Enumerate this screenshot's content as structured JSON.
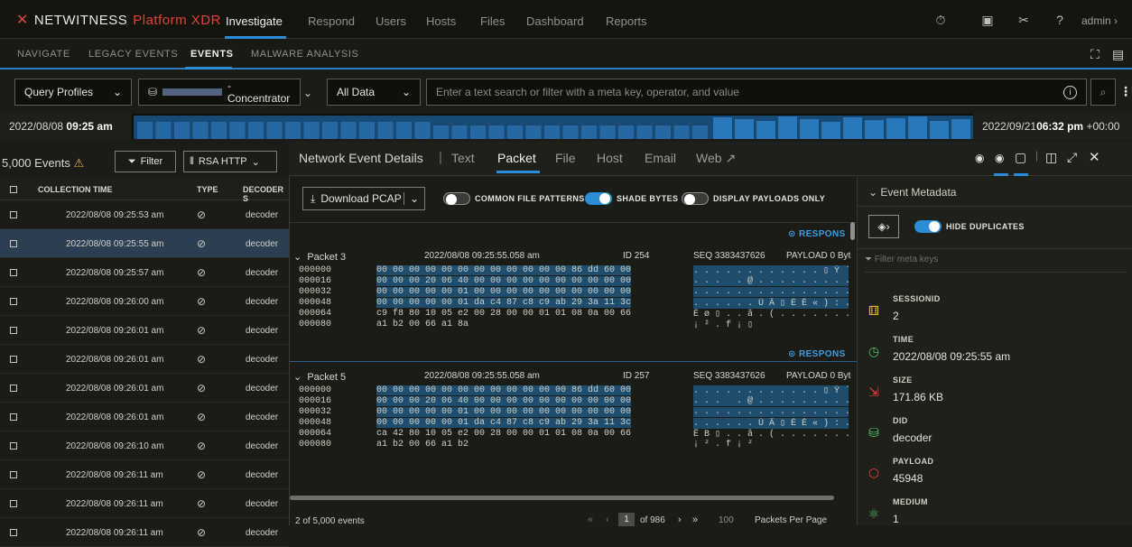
{
  "topbar": {
    "brand": "NETWITNESS",
    "platform": "Platform XDR",
    "nav": [
      "Investigate",
      "Respond",
      "Users",
      "Hosts",
      "Files",
      "Dashboard",
      "Reports"
    ],
    "user": "admin",
    "icons": [
      "stopwatch-icon",
      "notes-icon",
      "tools-icon",
      "help-icon"
    ]
  },
  "subnav": {
    "items": [
      "NAVIGATE",
      "LEGACY EVENTS",
      "EVENTS",
      "MALWARE ANALYSIS"
    ]
  },
  "query": {
    "profiles": "Query Profiles",
    "concentrator": "- Concentrator",
    "data": "All Data",
    "placeholder": "Enter a text search or filter with a meta key, operator, and value"
  },
  "timeline": {
    "start_date": "2022/08/08",
    "start_time": "09:25 am",
    "end_date": "2022/09/21",
    "end_time": "06:32 pm",
    "end_tz": "+00:00"
  },
  "events": {
    "count": "5,000 Events",
    "filter": "Filter",
    "service": "RSA HTTP",
    "columns": [
      "COLLECTION TIME",
      "TYPE",
      "DECODER S"
    ],
    "rows": [
      {
        "time": "2022/08/08 09:25:53 am",
        "type": "decoder"
      },
      {
        "time": "2022/08/08 09:25:55 am",
        "type": "decoder"
      },
      {
        "time": "2022/08/08 09:25:57 am",
        "type": "decoder"
      },
      {
        "time": "2022/08/08 09:26:00 am",
        "type": "decoder"
      },
      {
        "time": "2022/08/08 09:26:01 am",
        "type": "decoder"
      },
      {
        "time": "2022/08/08 09:26:01 am",
        "type": "decoder"
      },
      {
        "time": "2022/08/08 09:26:01 am",
        "type": "decoder"
      },
      {
        "time": "2022/08/08 09:26:01 am",
        "type": "decoder"
      },
      {
        "time": "2022/08/08 09:26:10 am",
        "type": "decoder"
      },
      {
        "time": "2022/08/08 09:26:11 am",
        "type": "decoder"
      },
      {
        "time": "2022/08/08 09:26:11 am",
        "type": "decoder"
      },
      {
        "time": "2022/08/08 09:26:11 am",
        "type": "decoder"
      }
    ]
  },
  "details": {
    "title": "Network Event Details",
    "tabs": [
      "Text",
      "Packet",
      "File",
      "Host",
      "Email",
      "Web"
    ],
    "download": "Download PCAP",
    "toggles": [
      "COMMON FILE PATTERNS",
      "SHADE BYTES",
      "DISPLAY PAYLOADS ONLY"
    ],
    "response": "RESPONS",
    "packets": [
      {
        "name": "Packet 3",
        "time": "2022/08/08 09:25:55.058 am",
        "id": "ID 254",
        "seq": "SEQ 3383437626",
        "payload": "PAYLOAD 0 Byte",
        "offsets": [
          "000000",
          "000016",
          "000032",
          "000048",
          "000064",
          "000080"
        ],
        "hex": [
          "00 00 00 00 00 00 00 00 00 00 00 00 86 dd 60 00",
          "00 00 00 20 06 40 00 00 00 00 00 00 00 00 00 00",
          "00 00 00 00 00 01 00 00 00 00 00 00 00 00 00 00",
          "00 00 00 00 00 01 da c4 87 c8 c9 ab 29 3a 11 3c",
          "c9 f8 80 10 05 e2 00 28 00 00 01 01 08 0a 00 66",
          "a1 b2 00 66 a1 8a"
        ],
        "ascii": [
          ". . . . . . . . . . . . ▯ Ý `",
          ". . .   . @ . . . . . . . . . .",
          ". . . . . . . . . . . . . . . .",
          ". . . . . . Ú Ä ▯ È É « ) : .",
          "É ø ▯ . . â . ( . . . . . . . .",
          "¡ ² . f ¡ ▯"
        ]
      },
      {
        "name": "Packet 5",
        "time": "2022/08/08 09:25:55.058 am",
        "id": "ID 257",
        "seq": "SEQ 3383437626",
        "payload": "PAYLOAD 0 Byte",
        "offsets": [
          "000000",
          "000016",
          "000032",
          "000048",
          "000064",
          "000080"
        ],
        "hex": [
          "00 00 00 00 00 00 00 00 00 00 00 00 86 dd 60 00",
          "00 00 00 20 06 40 00 00 00 00 00 00 00 00 00 00",
          "00 00 00 00 00 01 00 00 00 00 00 00 00 00 00 00",
          "00 00 00 00 00 01 da c4 87 c8 c9 ab 29 3a 11 3c",
          "ca 42 80 10 05 e2 00 28 00 00 01 01 08 0a 00 66",
          "a1 b2 00 66 a1 b2"
        ],
        "ascii": [
          ". . . . . . . . . . . . ▯ Ý `",
          ". . .   . @ . . . . . . . . . .",
          ". . . . . . . . . . . . . . . .",
          ". . . . . . Ú Ä ▯ È É « ) : .",
          "Ê B ▯ . . â . ( . . . . . . . .",
          "¡ ² . f ¡ ²"
        ]
      }
    ],
    "footer": {
      "count": "2 of 5,000 events",
      "page": "1",
      "of": "of 986",
      "per": "100",
      "per_label": "Packets Per Page"
    }
  },
  "metadata": {
    "title": "Event Metadata",
    "hide_dup": "HIDE DUPLICATES",
    "filter_placeholder": "Filter meta keys",
    "items": [
      {
        "key": "SESSIONID",
        "value": "2"
      },
      {
        "key": "TIME",
        "value": "2022/08/08 09:25:55 am"
      },
      {
        "key": "SIZE",
        "value": "171.86 KB"
      },
      {
        "key": "DID",
        "value": "decoder"
      },
      {
        "key": "PAYLOAD",
        "value": "45948"
      },
      {
        "key": "MEDIUM",
        "value": "1"
      }
    ]
  }
}
